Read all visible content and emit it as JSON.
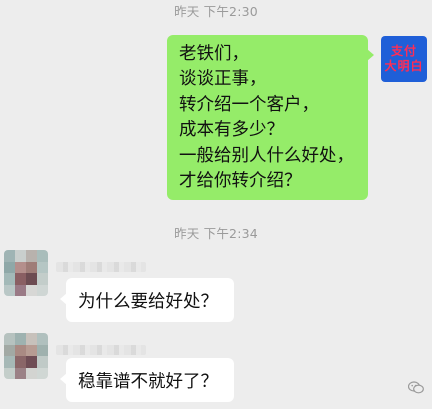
{
  "chat": {
    "timestamp_1": "昨天 下午2:30",
    "timestamp_2": "昨天 下午2:34",
    "outgoing": {
      "lines": [
        "老铁们，",
        "谈谈正事，",
        "转介绍一个客户，",
        "成本有多少？",
        "一般给别人什么好处，",
        "才给你转介绍？"
      ]
    },
    "self_avatar": {
      "line1": "支付",
      "line2": "大明白",
      "bg_color": "#1f5fd8",
      "text_color": "#ff2d55"
    },
    "incoming": [
      {
        "text": "为什么要给好处？"
      },
      {
        "text": "稳靠谱不就好了？"
      }
    ],
    "colors": {
      "outgoing_bubble": "#95ec69",
      "incoming_bubble": "#ffffff",
      "background": "#ededed"
    }
  },
  "watermark": {
    "icon": "wechat-official-account-icon"
  }
}
